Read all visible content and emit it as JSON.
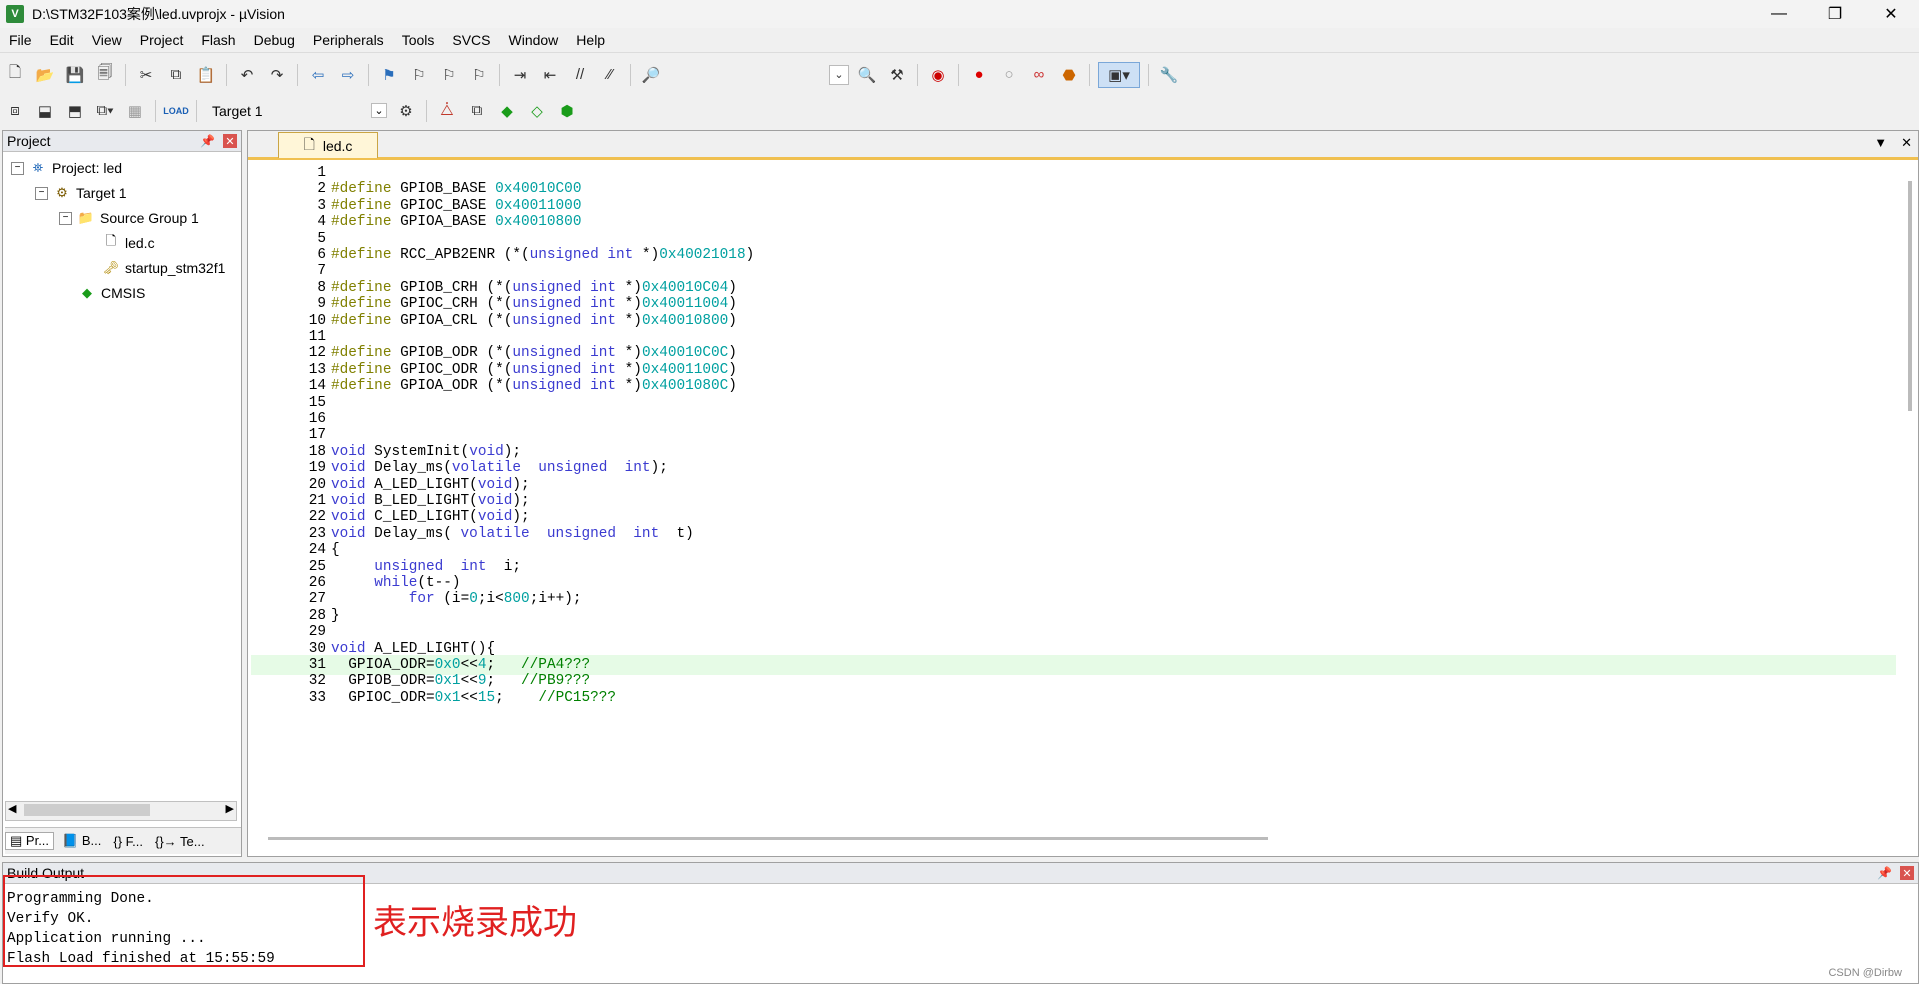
{
  "window": {
    "title": "D:\\STM32F103案例\\led.uvprojx - µVision",
    "controls": [
      "—",
      "❐",
      "✕"
    ]
  },
  "menu": [
    "File",
    "Edit",
    "View",
    "Project",
    "Flash",
    "Debug",
    "Peripherals",
    "Tools",
    "SVCS",
    "Window",
    "Help"
  ],
  "toolbar2": {
    "target": "Target 1"
  },
  "project_panel": {
    "title": "Project",
    "tree": {
      "project": "Project: led",
      "target": "Target 1",
      "group": "Source Group 1",
      "file1": "led.c",
      "file2": "startup_stm32f1",
      "cmsis": "CMSIS"
    },
    "tabs": [
      "Pr...",
      "B...",
      "{} F...",
      "{}→ Te..."
    ]
  },
  "editor": {
    "tab": "led.c",
    "lines": [
      {
        "n": "1",
        "t": ""
      },
      {
        "n": "2",
        "t": "#define GPIOB_BASE 0x40010C00"
      },
      {
        "n": "3",
        "t": "#define GPIOC_BASE 0x40011000"
      },
      {
        "n": "4",
        "t": "#define GPIOA_BASE 0x40010800"
      },
      {
        "n": "5",
        "t": ""
      },
      {
        "n": "6",
        "t": "#define RCC_APB2ENR (*(unsigned int *)0x40021018)"
      },
      {
        "n": "7",
        "t": ""
      },
      {
        "n": "8",
        "t": "#define GPIOB_CRH (*(unsigned int *)0x40010C04)"
      },
      {
        "n": "9",
        "t": "#define GPIOC_CRH (*(unsigned int *)0x40011004)"
      },
      {
        "n": "10",
        "t": "#define GPIOA_CRL (*(unsigned int *)0x40010800)"
      },
      {
        "n": "11",
        "t": ""
      },
      {
        "n": "12",
        "t": "#define GPIOB_ODR (*(unsigned int *)0x40010C0C)"
      },
      {
        "n": "13",
        "t": "#define GPIOC_ODR (*(unsigned int *)0x4001100C)"
      },
      {
        "n": "14",
        "t": "#define GPIOA_ODR (*(unsigned int *)0x4001080C)"
      },
      {
        "n": "15",
        "t": ""
      },
      {
        "n": "16",
        "t": ""
      },
      {
        "n": "17",
        "t": ""
      },
      {
        "n": "18",
        "t": "void SystemInit(void);"
      },
      {
        "n": "19",
        "t": "void Delay_ms(volatile  unsigned  int);"
      },
      {
        "n": "20",
        "t": "void A_LED_LIGHT(void);"
      },
      {
        "n": "21",
        "t": "void B_LED_LIGHT(void);"
      },
      {
        "n": "22",
        "t": "void C_LED_LIGHT(void);"
      },
      {
        "n": "23",
        "t": "void Delay_ms( volatile  unsigned  int  t)"
      },
      {
        "n": "24",
        "t": "{"
      },
      {
        "n": "25",
        "t": "     unsigned  int  i;"
      },
      {
        "n": "26",
        "t": "     while(t--)"
      },
      {
        "n": "27",
        "t": "         for (i=0;i<800;i++);"
      },
      {
        "n": "28",
        "t": "}"
      },
      {
        "n": "29",
        "t": ""
      },
      {
        "n": "30",
        "t": "void A_LED_LIGHT(){"
      },
      {
        "n": "31",
        "t": "  GPIOA_ODR=0x0<<4;   //PA4???"
      },
      {
        "n": "32",
        "t": "  GPIOB_ODR=0x1<<9;   //PB9???"
      },
      {
        "n": "33",
        "t": "  GPIOC_ODR=0x1<<15;    //PC15???"
      }
    ]
  },
  "build": {
    "title": "Build Output",
    "lines": [
      "Programming Done.",
      "Verify OK.",
      "Application running ...",
      "Flash Load finished at 15:55:59"
    ],
    "annotation": "表示烧录成功",
    "watermark": "CSDN @Dirbw"
  },
  "colors": {
    "annotation": "#e02020",
    "keyword": "#3b3bd0",
    "preprocessor": "#808000",
    "number": "#00a0a0",
    "comment": "#008000"
  }
}
